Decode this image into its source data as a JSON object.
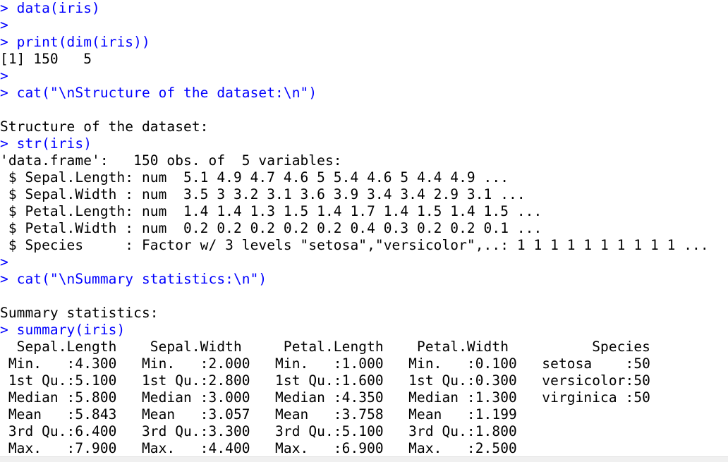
{
  "console": {
    "lines": [
      {
        "type": "input",
        "prompt": "> ",
        "text": "data(iris)"
      },
      {
        "type": "input",
        "prompt": ">",
        "text": ""
      },
      {
        "type": "input",
        "prompt": "> ",
        "text": "print(dim(iris))"
      },
      {
        "type": "output",
        "text": "[1] 150   5"
      },
      {
        "type": "input",
        "prompt": ">",
        "text": ""
      },
      {
        "type": "input",
        "prompt": "> ",
        "text": "cat(\"\\nStructure of the dataset:\\n\")"
      },
      {
        "type": "output",
        "text": ""
      },
      {
        "type": "output",
        "text": "Structure of the dataset:"
      },
      {
        "type": "input",
        "prompt": "> ",
        "text": "str(iris)"
      },
      {
        "type": "output",
        "text": "'data.frame':   150 obs. of  5 variables:"
      },
      {
        "type": "output",
        "text": " $ Sepal.Length: num  5.1 4.9 4.7 4.6 5 5.4 4.6 5 4.4 4.9 ..."
      },
      {
        "type": "output",
        "text": " $ Sepal.Width : num  3.5 3 3.2 3.1 3.6 3.9 3.4 3.4 2.9 3.1 ..."
      },
      {
        "type": "output",
        "text": " $ Petal.Length: num  1.4 1.4 1.3 1.5 1.4 1.7 1.4 1.5 1.4 1.5 ..."
      },
      {
        "type": "output",
        "text": " $ Petal.Width : num  0.2 0.2 0.2 0.2 0.2 0.4 0.3 0.2 0.2 0.1 ..."
      },
      {
        "type": "output",
        "text": " $ Species     : Factor w/ 3 levels \"setosa\",\"versicolor\",..: 1 1 1 1 1 1 1 1 1 1 ..."
      },
      {
        "type": "input",
        "prompt": ">",
        "text": ""
      },
      {
        "type": "input",
        "prompt": "> ",
        "text": "cat(\"\\nSummary statistics:\\n\")"
      },
      {
        "type": "output",
        "text": ""
      },
      {
        "type": "output",
        "text": "Summary statistics:"
      },
      {
        "type": "input",
        "prompt": "> ",
        "text": "summary(iris)"
      },
      {
        "type": "output",
        "text": "  Sepal.Length    Sepal.Width     Petal.Length    Petal.Width          Species  "
      },
      {
        "type": "output",
        "text": " Min.   :4.300   Min.   :2.000   Min.   :1.000   Min.   :0.100   setosa    :50  "
      },
      {
        "type": "output",
        "text": " 1st Qu.:5.100   1st Qu.:2.800   1st Qu.:1.600   1st Qu.:0.300   versicolor:50  "
      },
      {
        "type": "output",
        "text": " Median :5.800   Median :3.000   Median :4.350   Median :1.300   virginica :50  "
      },
      {
        "type": "output",
        "text": " Mean   :5.843   Mean   :3.057   Mean   :3.758   Mean   :1.199                  "
      },
      {
        "type": "output",
        "text": " 3rd Qu.:6.400   3rd Qu.:3.300   3rd Qu.:5.100   3rd Qu.:1.800                  "
      },
      {
        "type": "output",
        "text": " Max.   :7.900   Max.   :4.400   Max.   :6.900   Max.   :2.500                  "
      }
    ]
  },
  "colors": {
    "command": "#0000ff",
    "output": "#000000",
    "background": "#ffffff"
  }
}
